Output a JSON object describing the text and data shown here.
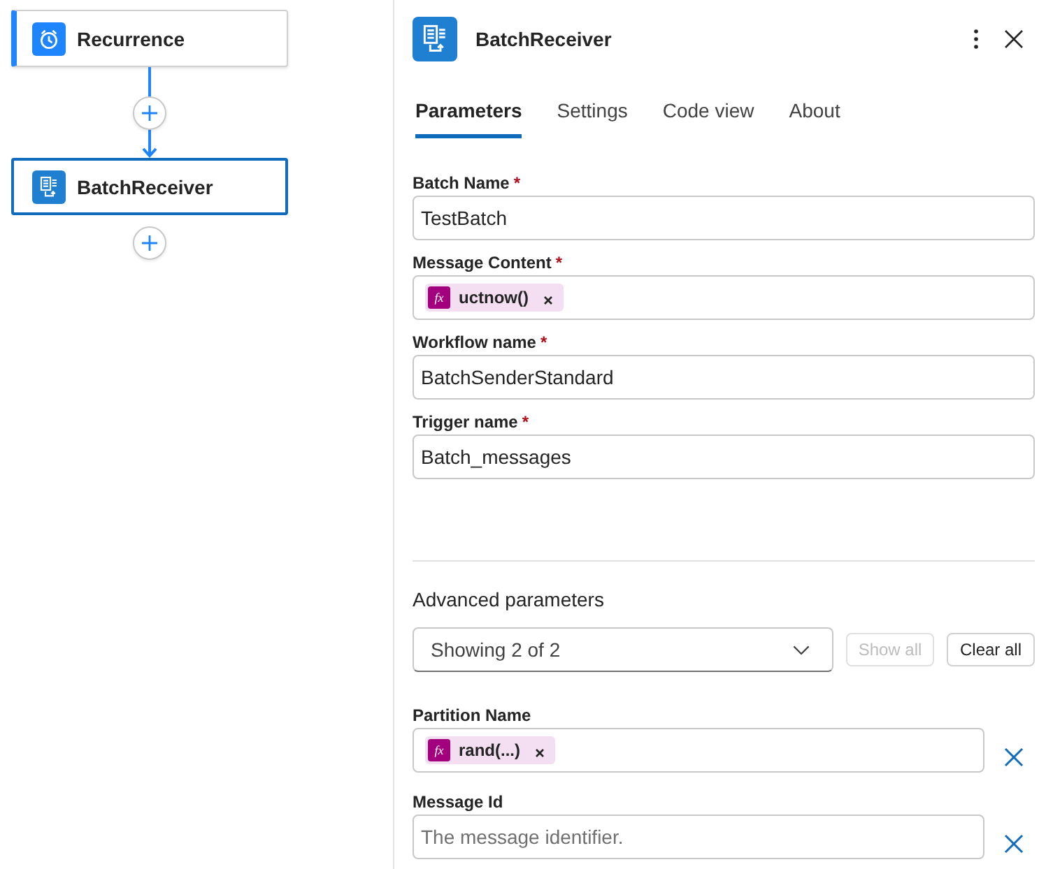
{
  "canvas": {
    "nodes": [
      {
        "title": "Recurrence",
        "kind": "trigger",
        "selected": false
      },
      {
        "title": "BatchReceiver",
        "kind": "batch",
        "selected": true
      }
    ]
  },
  "panel": {
    "title": "BatchReceiver",
    "kind": "batch",
    "tabs": [
      {
        "label": "Parameters",
        "selected": true
      },
      {
        "label": "Settings",
        "selected": false
      },
      {
        "label": "Code view",
        "selected": false
      },
      {
        "label": "About",
        "selected": false
      }
    ],
    "fields": [
      {
        "label": "Batch Name",
        "required_mark": "*",
        "kind": "text",
        "value": "TestBatch"
      },
      {
        "label": "Message Content",
        "required_mark": "*",
        "kind": "tokens",
        "tokens": [
          {
            "tag": "fx",
            "label": "uctnow()"
          }
        ]
      },
      {
        "label": "Workflow name",
        "required_mark": "*",
        "kind": "text",
        "value": "BatchSenderStandard"
      },
      {
        "label": "Trigger name",
        "required_mark": "*",
        "kind": "text",
        "value": "Batch_messages"
      }
    ],
    "advanced": {
      "label": "Advanced parameters",
      "dropdown": "Showing 2 of 2",
      "buttons": [
        {
          "label": "Show all",
          "disabled": true
        },
        {
          "label": "Clear all",
          "disabled": false
        }
      ],
      "fields": [
        {
          "label": "Partition Name",
          "kind": "tokens",
          "tokens": [
            {
              "tag": "fx",
              "label": "rand(...)"
            }
          ]
        },
        {
          "label": "Message Id",
          "kind": "text",
          "placeholder": "The message identifier."
        }
      ]
    }
  }
}
